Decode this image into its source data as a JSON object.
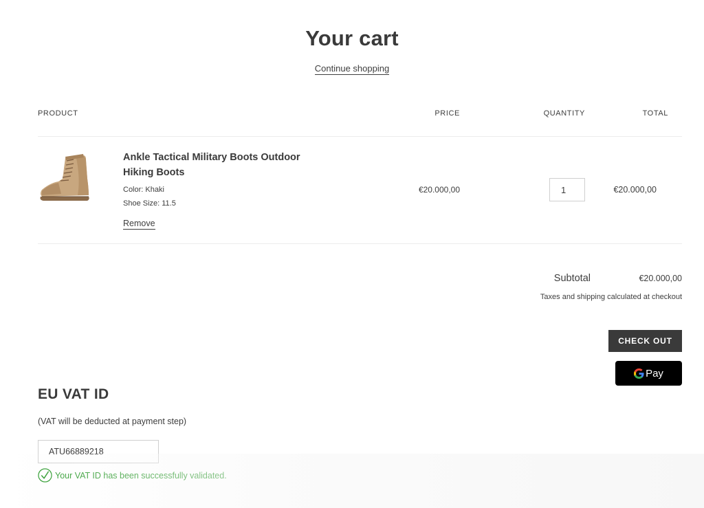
{
  "header": {
    "title": "Your cart",
    "continue_shopping": "Continue shopping"
  },
  "table": {
    "headers": {
      "product": "PRODUCT",
      "price": "PRICE",
      "quantity": "QUANTITY",
      "total": "TOTAL"
    },
    "items": [
      {
        "name": "Ankle Tactical Military Boots Outdoor Hiking Boots",
        "image_icon": "tan-boot-image",
        "options": [
          "Color: Khaki",
          "Shoe Size: 11.5"
        ],
        "remove_label": "Remove",
        "price": "€20.000,00",
        "quantity": "1",
        "total": "€20.000,00"
      }
    ]
  },
  "summary": {
    "subtotal_label": "Subtotal",
    "subtotal_value": "€20.000,00",
    "tax_note": "Taxes and shipping calculated at checkout",
    "checkout_label": "CHECK OUT",
    "gpay_label": "Pay"
  },
  "vat": {
    "title": "EU VAT ID",
    "note": "(VAT will be deducted at payment step)",
    "value": "ATU66889218",
    "success_message": "Your VAT ID has been successfully validated."
  },
  "colors": {
    "text": "#3d3d3d",
    "checkout_bg": "#3a3a3a",
    "gpay_bg": "#000000",
    "success": "#2b9a2b",
    "border": "#cfcfcf"
  }
}
